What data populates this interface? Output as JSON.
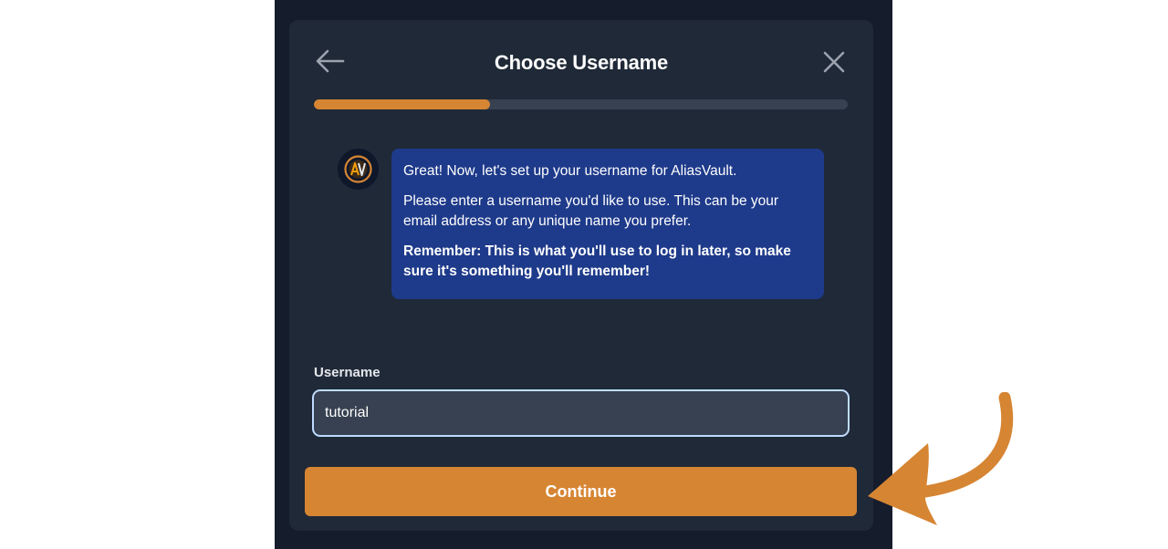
{
  "dialog": {
    "title": "Choose Username",
    "progress_fraction": 0.33
  },
  "icons": {
    "back": "arrow-left-icon",
    "close": "close-icon",
    "avatar": "aliasvault-logo",
    "annotation": "curved-arrow"
  },
  "message": {
    "line1": "Great! Now, let's set up your username for AliasVault.",
    "line2": "Please enter a username you'd like to use. This can be your email address or any unique name you prefer.",
    "line3": "Remember: This is what you'll use to log in later, so make sure it's something you'll remember!"
  },
  "form": {
    "username_label": "Username",
    "username_value": "tutorial"
  },
  "actions": {
    "continue_label": "Continue"
  },
  "colors": {
    "accent": "#d68533",
    "background": "#151c2c",
    "card": "#1f2937",
    "bubble": "#1e3a8a"
  }
}
